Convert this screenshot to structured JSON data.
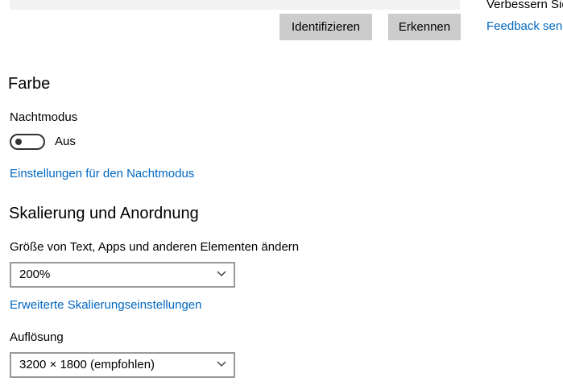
{
  "display": {
    "identify_label": "Identifizieren",
    "detect_label": "Erkennen"
  },
  "side_panel": {
    "improve_text": "Verbessern Sie",
    "feedback_link": "Feedback send"
  },
  "color_section": {
    "heading": "Farbe",
    "night_mode_label": "Nachtmodus",
    "night_mode_state": "Aus",
    "night_mode_on": false,
    "night_mode_settings_link": "Einstellungen für den Nachtmodus"
  },
  "scale_section": {
    "heading": "Skalierung und Anordnung",
    "size_label": "Größe von Text, Apps und anderen Elementen ändern",
    "size_value": "200%",
    "advanced_link": "Erweiterte Skalierungseinstellungen",
    "resolution_label": "Auflösung",
    "resolution_value": "3200 × 1800 (empfohlen)"
  },
  "colors": {
    "accent": "#0067c0",
    "button_bg": "#cccccc",
    "toggle_off": "#333333"
  },
  "icons": {
    "toggle_knob": "toggle-knob-icon",
    "dropdown_arrow": "chevron-down-icon"
  }
}
